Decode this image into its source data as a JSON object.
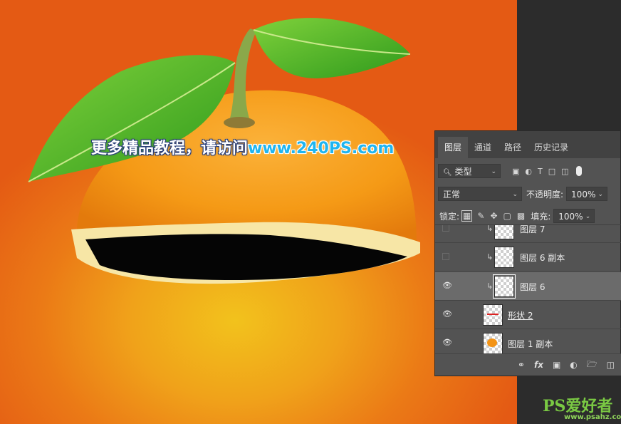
{
  "promo": {
    "part1": "更多精品教程，请访问",
    "part2": "www.240PS.com"
  },
  "watermark": {
    "main": "PS爱好者",
    "sub": "www.psahz.com"
  },
  "layers_panel": {
    "tabs": [
      "图层",
      "通道",
      "路径",
      "历史记录"
    ],
    "active_tab": "图层",
    "filter": {
      "label": "类型",
      "icons": [
        "image-filter-icon",
        "adjustment-filter-icon",
        "type-filter-icon",
        "shape-filter-icon",
        "smart-object-filter-icon"
      ]
    },
    "blend_mode": "正常",
    "opacity_label": "不透明度:",
    "opacity_value": "100%",
    "lock_label": "锁定:",
    "fill_label": "填充:",
    "fill_value": "100%",
    "layers": [
      {
        "name": "图层 7",
        "visible": false,
        "clipped": true,
        "selected": false,
        "thumb": "transparent"
      },
      {
        "name": "图层 6 副本",
        "visible": false,
        "clipped": true,
        "selected": false,
        "thumb": "transparent"
      },
      {
        "name": "图层 6",
        "visible": true,
        "clipped": true,
        "selected": true,
        "thumb": "transparent"
      },
      {
        "name": "形状 2",
        "visible": true,
        "clipped": false,
        "selected": false,
        "thumb": "shape"
      },
      {
        "name": "图层 1 副本",
        "visible": true,
        "clipped": false,
        "selected": false,
        "thumb": "orange"
      }
    ],
    "bottom_icons": [
      "link-icon",
      "fx-icon",
      "mask-icon",
      "adjustment-icon",
      "folder-icon",
      "new-layer-icon"
    ]
  },
  "colors": {
    "canvas_center": "#f2c21c",
    "canvas_edge": "#e45a14",
    "panel_bg": "#535353",
    "selected_layer": "#6b6b6b"
  }
}
